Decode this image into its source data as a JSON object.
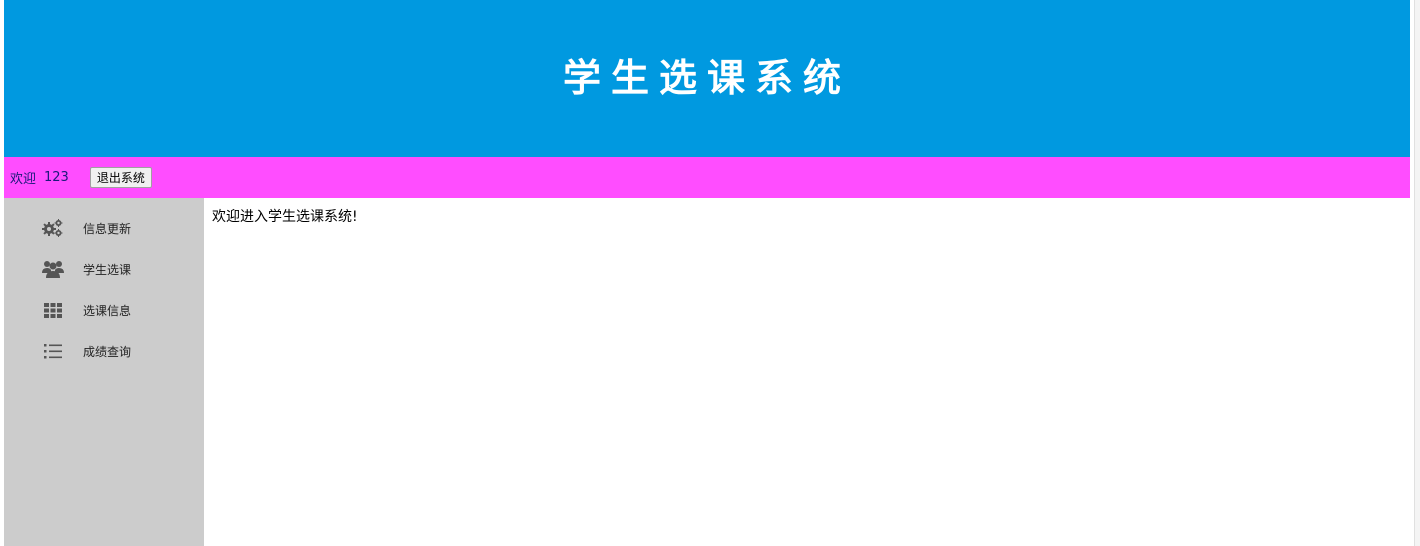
{
  "header": {
    "title": "学生选课系统",
    "background": "#0099e0"
  },
  "welcome_bar": {
    "greeting": "欢迎",
    "username": "123",
    "logout_label": "退出系统",
    "background": "#ff4dff"
  },
  "sidebar": {
    "background": "#cccccc",
    "items": [
      {
        "label": "信息更新",
        "icon": "gears-icon"
      },
      {
        "label": "学生选课",
        "icon": "users-icon"
      },
      {
        "label": "选课信息",
        "icon": "grid-icon"
      },
      {
        "label": "成绩查询",
        "icon": "list-icon"
      }
    ]
  },
  "content": {
    "message": "欢迎进入学生选课系统!"
  }
}
